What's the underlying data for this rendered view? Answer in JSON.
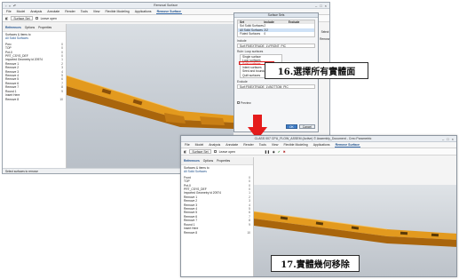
{
  "window1": {
    "title": "Removal Surface",
    "menu": [
      "File",
      "Model",
      "Analysis",
      "Annotate",
      "Render",
      "Tools",
      "View",
      "Flexible Modeling",
      "Applications",
      "Remove Surface"
    ],
    "menu_active_index": 9,
    "toolbar": {
      "field_label": "Surface Set",
      "checkbox_label": "Leave open"
    },
    "subtabs": [
      "References",
      "Options",
      "Properties"
    ],
    "tree_header": [
      "Surfaces & items to",
      "All Solid Surfaces"
    ],
    "tree_items": [
      {
        "label": "Prev",
        "count": "0"
      },
      {
        "label": "TOP",
        "count": "0"
      },
      {
        "label": "Pnt-0",
        "count": "0"
      },
      {
        "label": "PRT_CSYS_DEF",
        "count": "0"
      },
      {
        "label": "Imported Geometry id 20974",
        "count": "1"
      },
      {
        "label": "Remove 1",
        "count": "2"
      },
      {
        "label": "Remove 2",
        "count": "3"
      },
      {
        "label": "Remove 3",
        "count": "4"
      },
      {
        "label": "Remove 4",
        "count": "5"
      },
      {
        "label": "Remove 5",
        "count": "6"
      },
      {
        "label": "Remove 6",
        "count": "7"
      },
      {
        "label": "Remove 7",
        "count": "8"
      },
      {
        "label": "Round 1",
        "count": "9"
      },
      {
        "label": "Insert Here",
        "count": ""
      },
      {
        "label": "Remove 8",
        "count": "10"
      }
    ],
    "status": "Select surfaces to remove"
  },
  "dialog": {
    "title": "Surface Sets",
    "table_head": [
      "Set",
      "Include",
      "Exclude"
    ],
    "table_rows": [
      [
        "Sol Solid Surfaces",
        "2",
        ""
      ],
      [
        "All Solid Surfaces",
        "2/2",
        ""
      ],
      [
        "Fluted Surfaces",
        "0",
        ""
      ]
    ],
    "section_include": "Include",
    "field_include": "Surf:F5(EXTRUDE_1):FRONT_PIC",
    "section_rule": "Rule",
    "rule_value": "Loop surfaces",
    "dropdown": [
      "Single surface",
      "Loop surfaces",
      "Solid surfaces",
      "Intent surfaces",
      "Seed and boundary",
      "Quilt surfaces"
    ],
    "dropdown_selected_index": 2,
    "section_exclude": "Exclude",
    "field_exclude": "Surf:F5(EXTRUDE_1):BOTTOM_PIC",
    "preview_label": "Preview",
    "ok_label": "OK",
    "cancel_label": "Cancel",
    "side_buttons": [
      "Select",
      "Remove"
    ]
  },
  "callout1": {
    "text": "16.選擇所有實體面"
  },
  "arrow": {
    "color": "#e51c1c"
  },
  "window2": {
    "title": "CLASS 007 CPU_FLOW_ASSEM (Active) © Assembly_Document - Creo Parametric",
    "menu": [
      "File",
      "Model",
      "Analysis",
      "Annotate",
      "Render",
      "Tools",
      "View",
      "Flexible Modeling",
      "Applications",
      "Remove Surface"
    ],
    "menu_active_index": 9,
    "toolbar": {
      "field_label": "Surface Set",
      "checkbox_label": "Leave open"
    },
    "subtabs": [
      "References",
      "Options",
      "Properties"
    ],
    "tree_header": [
      "Surfaces & items to",
      "All Solid Surfaces"
    ],
    "tree_items": [
      {
        "label": "Front",
        "count": "0"
      },
      {
        "label": "TOP",
        "count": "0"
      },
      {
        "label": "Pnt-0",
        "count": "0"
      },
      {
        "label": "PRT_CSYS_DEF",
        "count": "0"
      },
      {
        "label": "Imported Geometry id 20974",
        "count": "1"
      },
      {
        "label": "Remove 1",
        "count": "2"
      },
      {
        "label": "Remove 2",
        "count": "3"
      },
      {
        "label": "Remove 3",
        "count": "4"
      },
      {
        "label": "Remove 4",
        "count": "5"
      },
      {
        "label": "Remove 5",
        "count": "6"
      },
      {
        "label": "Remove 6",
        "count": "7"
      },
      {
        "label": "Remove 7",
        "count": "8"
      },
      {
        "label": "Round 1",
        "count": "9"
      },
      {
        "label": "Insert Here",
        "count": ""
      },
      {
        "label": "Remove 8",
        "count": "10"
      }
    ]
  },
  "callout2": {
    "text": "17.實體幾何移除"
  },
  "colors": {
    "part": "#e39a1e",
    "part_dark": "#a9650c",
    "accent": "#3a6fb0",
    "highlight": "#e01b1b"
  }
}
